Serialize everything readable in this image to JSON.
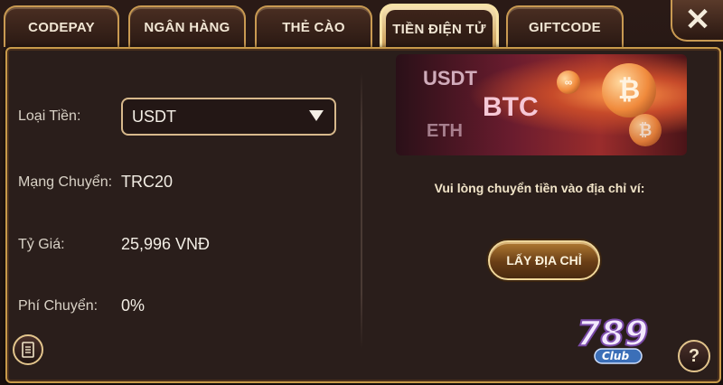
{
  "tabs": [
    {
      "label": "CODEPAY"
    },
    {
      "label": "NGÂN HÀNG"
    },
    {
      "label": "THẺ CÀO"
    },
    {
      "label": "TIỀN ĐIỆN TỬ",
      "active": true
    },
    {
      "label": "GIFTCODE"
    }
  ],
  "close_icon": "close-icon",
  "form": {
    "currency_label": "Loại Tiền:",
    "currency_value": "USDT",
    "network_label": "Mạng Chuyển:",
    "network_value": "TRC20",
    "rate_label": "Tỷ Giá:",
    "rate_value": "25,996 VNĐ",
    "fee_label": "Phí Chuyển:",
    "fee_value": "0%"
  },
  "banner": {
    "usdt": "USDT",
    "btc": "BTC",
    "eth": "ETH"
  },
  "instruction": "Vui lòng chuyển tiền vào địa chỉ ví:",
  "get_address_button": "LẤY ĐỊA CHỈ",
  "help_label": "?",
  "logo": {
    "number": "789",
    "suffix": "Club"
  },
  "colors": {
    "accent_gold": "#c99a52",
    "panel_bg": "#2a1e1b"
  }
}
